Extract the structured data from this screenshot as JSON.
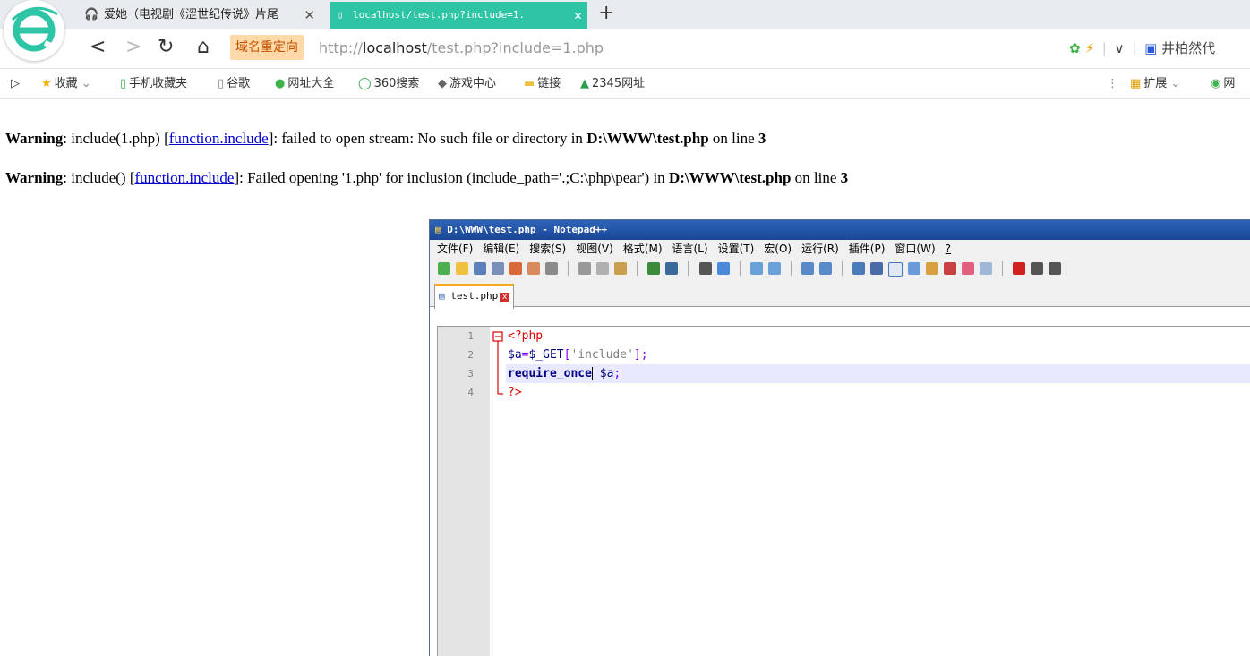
{
  "browser": {
    "tabs": [
      {
        "label": "爱她（电视剧《涩世纪传说》片尾",
        "active": false
      },
      {
        "label": "localhost/test.php?include=1.",
        "active": true
      }
    ],
    "redirect_badge": "域名重定向",
    "url": {
      "scheme": "http://",
      "host": "localhost",
      "path": "/test.php?include=1.php"
    },
    "right_text": "井柏然代",
    "bookmarks": [
      {
        "label": "收藏",
        "icon": "star-icon"
      },
      {
        "label": "手机收藏夹",
        "icon": "phone-icon"
      },
      {
        "label": "谷歌",
        "icon": "page-icon"
      },
      {
        "label": "网址大全",
        "icon": "compass-icon"
      },
      {
        "label": "360搜索",
        "icon": "search-icon"
      },
      {
        "label": "游戏中心",
        "icon": "gamepad-icon"
      },
      {
        "label": "链接",
        "icon": "folder-icon"
      },
      {
        "label": "2345网址",
        "icon": "home-icon"
      }
    ],
    "extensions_label": "扩展",
    "right_bookmark": "网"
  },
  "warnings": [
    {
      "prefix": "Warning",
      "text1": ": include(1.php) [",
      "link": "function.include",
      "text2": "]: failed to open stream: No such file or directory in ",
      "file": "D:\\WWW\\test.php",
      "text3": " on line ",
      "line": "3"
    },
    {
      "prefix": "Warning",
      "text1": ": include() [",
      "link": "function.include",
      "text2": "]: Failed opening '1.php' for inclusion (include_path='.;C:\\php\\pear') in ",
      "file": "D:\\WWW\\test.php",
      "text3": " on line ",
      "line": "3"
    }
  ],
  "notepad": {
    "title": "D:\\WWW\\test.php - Notepad++",
    "menu": [
      "文件(F)",
      "编辑(E)",
      "搜索(S)",
      "视图(V)",
      "格式(M)",
      "语言(L)",
      "设置(T)",
      "宏(O)",
      "运行(R)",
      "插件(P)",
      "窗口(W)",
      "?"
    ],
    "tab": "test.php",
    "line_numbers": [
      "1",
      "2",
      "3",
      "4"
    ],
    "code": {
      "l1": "<?php",
      "l2_var": "$a",
      "l2_eq": "=",
      "l2_get": "$_GET",
      "l2_open": "[",
      "l2_str": "'include'",
      "l2_close": "];",
      "l3_kw": "require_once",
      "l3_var": " $a",
      "l3_end": ";",
      "l4": "?>"
    }
  },
  "colors": {
    "active_tab": "#2ec5a7",
    "redirect_bg": "#ffd9a8",
    "link": "#0000cc"
  }
}
